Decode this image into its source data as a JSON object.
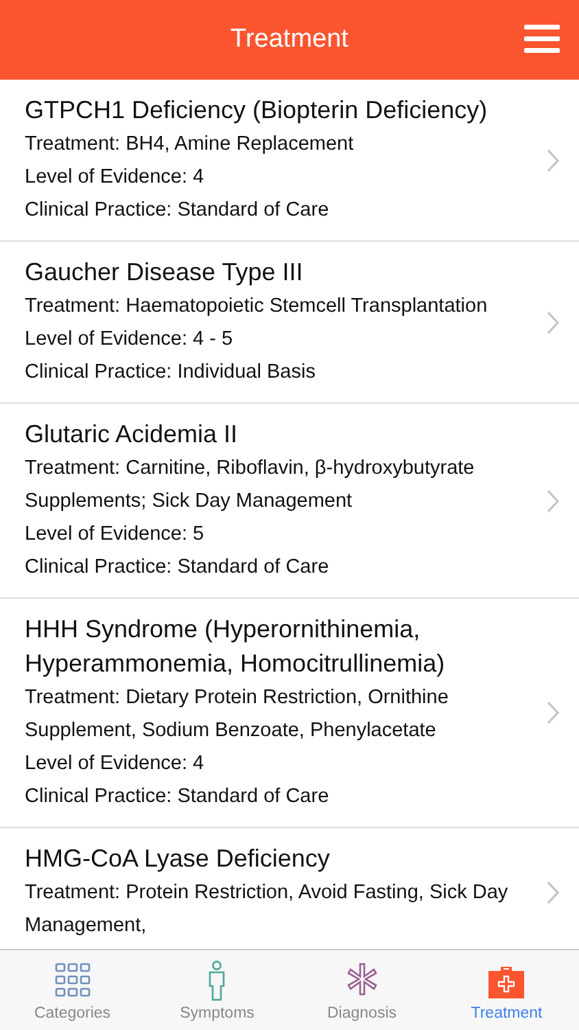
{
  "header": {
    "title": "Treatment"
  },
  "items": [
    {
      "title": "GTPCH1 Deficiency (Biopterin Deficiency)",
      "lines": [
        "Treatment: BH4, Amine Replacement",
        "Level of Evidence: 4",
        "Clinical Practice: Standard of Care"
      ]
    },
    {
      "title": "Gaucher Disease Type III",
      "lines": [
        "Treatment: Haematopoietic Stemcell Transplantation",
        "Level of Evidence: 4 - 5",
        "Clinical Practice: Individual Basis"
      ]
    },
    {
      "title": "Glutaric Acidemia II",
      "lines": [
        "Treatment: Carnitine, Riboflavin, β-hydroxybutyrate Supplements; Sick Day Management",
        "Level of Evidence: 5",
        "Clinical Practice: Standard of Care"
      ]
    },
    {
      "title": "HHH Syndrome (Hyperornithinemia, Hyperammonemia, Homocitrullinemia)",
      "lines": [
        "Treatment: Dietary Protein Restriction, Ornithine Supplement, Sodium Benzoate, Phenylacetate",
        "Level of Evidence: 4",
        "Clinical Practice: Standard of Care"
      ]
    },
    {
      "title": "HMG-CoA Lyase Deficiency",
      "lines": [
        "Treatment: Protein Restriction, Avoid Fasting, Sick Day Management,"
      ]
    }
  ],
  "tabs": [
    {
      "kind": "grid",
      "label": "Categories",
      "selected": false
    },
    {
      "kind": "person",
      "label": "Symptoms",
      "selected": false
    },
    {
      "kind": "asterisk",
      "label": "Diagnosis",
      "selected": false
    },
    {
      "kind": "kit",
      "label": "Treatment",
      "selected": true
    }
  ]
}
